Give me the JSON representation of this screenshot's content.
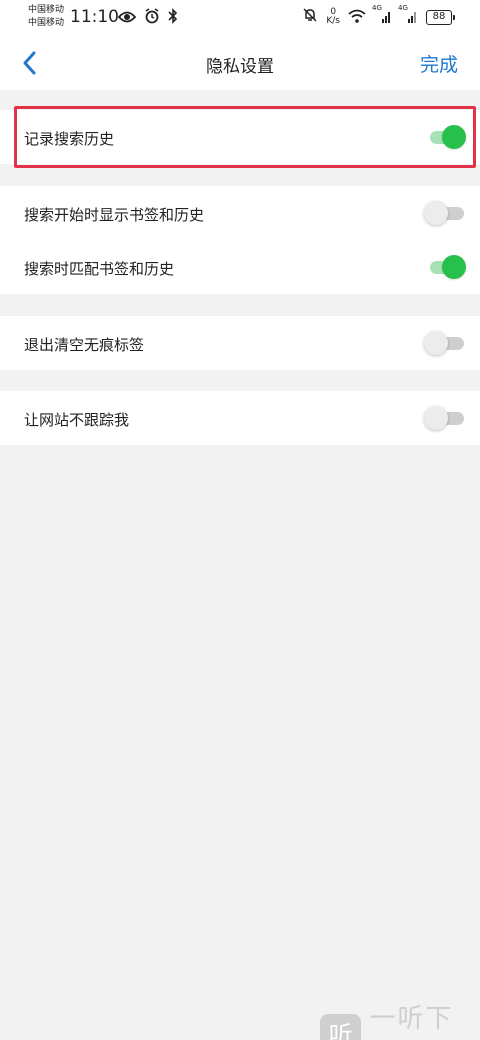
{
  "status_bar": {
    "carrier_1": "中国移动",
    "carrier_2": "中国移动",
    "time": "11:10",
    "net_speed_value": "0",
    "net_speed_unit": "K/s",
    "signal_1_label": "4G",
    "signal_2_label": "4G",
    "battery": "88",
    "icons": [
      "eye-icon",
      "alarm-icon",
      "bluetooth-icon",
      "mute-icon",
      "wifi-icon",
      "signal-icon"
    ]
  },
  "nav": {
    "title": "隐私设置",
    "done_label": "完成",
    "back_icon": "chevron-left-icon",
    "accent_color": "#1f78d1"
  },
  "settings": {
    "group_1": [
      {
        "label": "记录搜索历史",
        "on": true
      }
    ],
    "group_2": [
      {
        "label": "搜索开始时显示书签和历史",
        "on": false
      },
      {
        "label": "搜索时匹配书签和历史",
        "on": true
      }
    ],
    "group_3": [
      {
        "label": "退出清空无痕标签",
        "on": false
      }
    ],
    "group_4": [
      {
        "label": "让网站不跟踪我",
        "on": false
      }
    ]
  },
  "colors": {
    "toggle_on": "#27c04c",
    "highlight_border": "#e0334a"
  },
  "watermark": {
    "logo": "听",
    "text": "一听下载"
  }
}
